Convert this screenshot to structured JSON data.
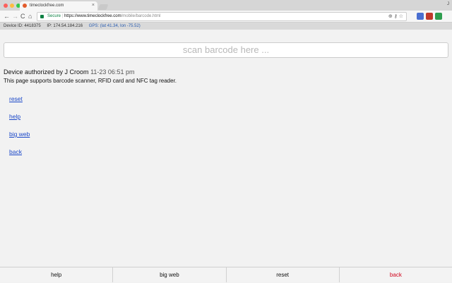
{
  "browser": {
    "tab_title": "timeclockfree.com",
    "tab_close": "×",
    "profile": "J",
    "nav_back": "←",
    "nav_forward": "→",
    "nav_reload": "C",
    "nav_home": "⌂",
    "secure_label": "Secure",
    "url_host": "https://www.timeclockfree.com",
    "url_path": "/mobile/barcode.html",
    "omni_icons": "⊕ ⚷ ☆"
  },
  "info": {
    "device_id": "Device ID: 4418375",
    "ip": "IP: 174.54.184.216",
    "gps": "GPS: (lat 41.34, lon -75.52)"
  },
  "scan": {
    "placeholder": "scan barcode here ..."
  },
  "auth": {
    "text": "Device authorized by J Croom",
    "time": "11-23 06:51 pm",
    "support": "This page supports barcode scanner, RFID card and NFC tag reader."
  },
  "links": {
    "reset": "reset",
    "help": "help",
    "big_web": "big web",
    "back": "back"
  },
  "footer": {
    "help": "help",
    "big_web": "big web",
    "reset": "reset",
    "back": "back"
  },
  "colors": {
    "link": "#1a47c8",
    "back_red": "#d0021b",
    "secure_green": "#0b8043"
  }
}
